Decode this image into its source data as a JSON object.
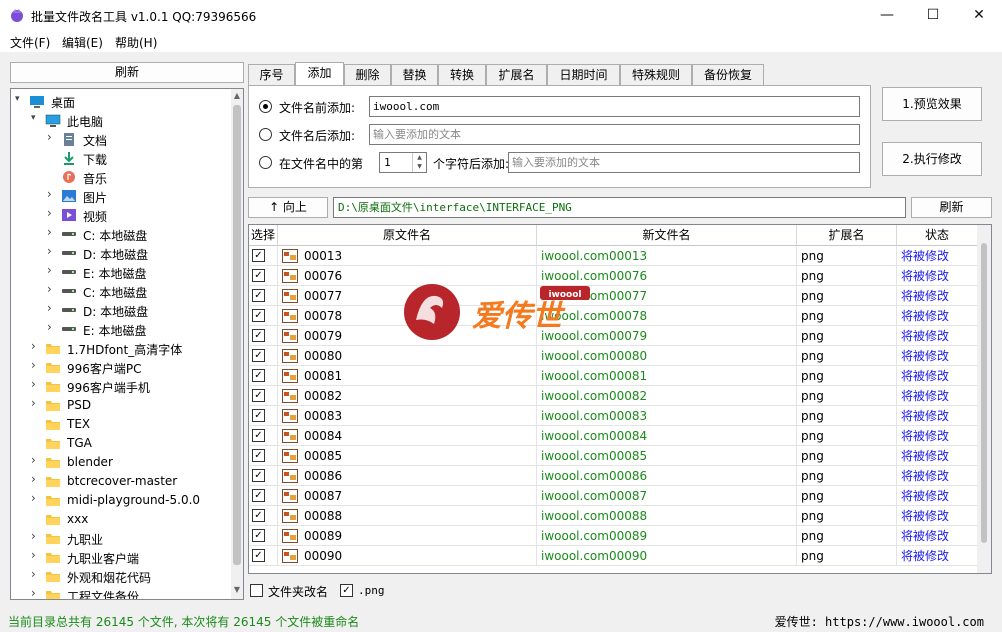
{
  "window": {
    "title": "批量文件改名工具 v1.0.1 QQ:79396566",
    "minimize": "—",
    "maximize": "☐",
    "close": "✕"
  },
  "menu": [
    "文件(F)",
    "编辑(E)",
    "帮助(H)"
  ],
  "left_panel": {
    "refresh_label": "刷新",
    "tree": [
      {
        "label": "桌面",
        "icon": "desktop-icon",
        "level": 0,
        "arrow": "open"
      },
      {
        "label": "此电脑",
        "icon": "computer-icon",
        "level": 1,
        "arrow": "open"
      },
      {
        "label": "文档",
        "icon": "document-icon",
        "level": 2,
        "arrow": "closed"
      },
      {
        "label": "下载",
        "icon": "download-icon",
        "level": 2,
        "arrow": "none"
      },
      {
        "label": "音乐",
        "icon": "music-icon",
        "level": 2,
        "arrow": "none"
      },
      {
        "label": "图片",
        "icon": "picture-icon",
        "level": 2,
        "arrow": "closed"
      },
      {
        "label": "视频",
        "icon": "video-icon",
        "level": 2,
        "arrow": "closed"
      },
      {
        "label": "C: 本地磁盘",
        "icon": "drive-icon",
        "level": 2,
        "arrow": "closed"
      },
      {
        "label": "D: 本地磁盘",
        "icon": "drive-icon",
        "level": 2,
        "arrow": "closed"
      },
      {
        "label": "E: 本地磁盘",
        "icon": "drive-icon",
        "level": 2,
        "arrow": "closed"
      },
      {
        "label": "C: 本地磁盘",
        "icon": "drive-icon",
        "level": 2,
        "arrow": "closed"
      },
      {
        "label": "D: 本地磁盘",
        "icon": "drive-icon",
        "level": 2,
        "arrow": "closed"
      },
      {
        "label": "E: 本地磁盘",
        "icon": "drive-icon",
        "level": 2,
        "arrow": "closed"
      },
      {
        "label": "1.7HDfont_高清字体",
        "icon": "folder-icon",
        "level": 1,
        "arrow": "closed"
      },
      {
        "label": "996客户端PC",
        "icon": "folder-icon",
        "level": 1,
        "arrow": "closed"
      },
      {
        "label": "996客户端手机",
        "icon": "folder-icon",
        "level": 1,
        "arrow": "closed"
      },
      {
        "label": "PSD",
        "icon": "folder-icon",
        "level": 1,
        "arrow": "closed"
      },
      {
        "label": "TEX",
        "icon": "folder-icon",
        "level": 1,
        "arrow": "none"
      },
      {
        "label": "TGA",
        "icon": "folder-icon",
        "level": 1,
        "arrow": "none"
      },
      {
        "label": "blender",
        "icon": "folder-icon",
        "level": 1,
        "arrow": "closed"
      },
      {
        "label": "btcrecover-master",
        "icon": "folder-icon",
        "level": 1,
        "arrow": "closed"
      },
      {
        "label": "midi-playground-5.0.0",
        "icon": "folder-icon",
        "level": 1,
        "arrow": "closed"
      },
      {
        "label": "xxx",
        "icon": "folder-icon",
        "level": 1,
        "arrow": "none"
      },
      {
        "label": "九职业",
        "icon": "folder-icon",
        "level": 1,
        "arrow": "closed"
      },
      {
        "label": "九职业客户端",
        "icon": "folder-icon",
        "level": 1,
        "arrow": "closed"
      },
      {
        "label": "外观和烟花代码",
        "icon": "folder-icon",
        "level": 1,
        "arrow": "closed"
      },
      {
        "label": "工程文件备份",
        "icon": "folder-icon",
        "level": 1,
        "arrow": "closed"
      }
    ]
  },
  "tabs": [
    {
      "label": "序号",
      "active": false
    },
    {
      "label": "添加",
      "active": true
    },
    {
      "label": "删除",
      "active": false
    },
    {
      "label": "替换",
      "active": false
    },
    {
      "label": "转换",
      "active": false
    },
    {
      "label": "扩展名",
      "active": false
    },
    {
      "label": "日期时间",
      "active": false
    },
    {
      "label": "特殊规则",
      "active": false
    },
    {
      "label": "备份恢复",
      "active": false
    }
  ],
  "add_tab": {
    "prefix_label": "文件名前添加:",
    "prefix_value": "iwoool.com",
    "suffix_label": "文件名后添加:",
    "suffix_placeholder": "输入要添加的文本",
    "middle_label_a": "在文件名中的第",
    "middle_position": "1",
    "middle_label_b": "个字符后添加:",
    "middle_placeholder": "输入要添加的文本",
    "selected": "prefix"
  },
  "actions": {
    "preview_label": "1.预览效果",
    "execute_label": "2.执行修改"
  },
  "nav": {
    "up_label": "↑ 向上",
    "path": "D:\\原桌面文件\\interface\\INTERFACE_PNG",
    "refresh_label": "刷新"
  },
  "grid": {
    "headers": [
      "选择",
      "原文件名",
      "新文件名",
      "扩展名",
      "状态"
    ],
    "rows": [
      {
        "orig": "00013",
        "new": "iwoool.com00013",
        "ext": "png",
        "status": "将被修改",
        "checked": true
      },
      {
        "orig": "00076",
        "new": "iwoool.com00076",
        "ext": "png",
        "status": "将被修改",
        "checked": true
      },
      {
        "orig": "00077",
        "new": "iwoool.com00077",
        "ext": "png",
        "status": "将被修改",
        "checked": true
      },
      {
        "orig": "00078",
        "new": "iwoool.com00078",
        "ext": "png",
        "status": "将被修改",
        "checked": true
      },
      {
        "orig": "00079",
        "new": "iwoool.com00079",
        "ext": "png",
        "status": "将被修改",
        "checked": true
      },
      {
        "orig": "00080",
        "new": "iwoool.com00080",
        "ext": "png",
        "status": "将被修改",
        "checked": true
      },
      {
        "orig": "00081",
        "new": "iwoool.com00081",
        "ext": "png",
        "status": "将被修改",
        "checked": true
      },
      {
        "orig": "00082",
        "new": "iwoool.com00082",
        "ext": "png",
        "status": "将被修改",
        "checked": true
      },
      {
        "orig": "00083",
        "new": "iwoool.com00083",
        "ext": "png",
        "status": "将被修改",
        "checked": true
      },
      {
        "orig": "00084",
        "new": "iwoool.com00084",
        "ext": "png",
        "status": "将被修改",
        "checked": true
      },
      {
        "orig": "00085",
        "new": "iwoool.com00085",
        "ext": "png",
        "status": "将被修改",
        "checked": true
      },
      {
        "orig": "00086",
        "new": "iwoool.com00086",
        "ext": "png",
        "status": "将被修改",
        "checked": true
      },
      {
        "orig": "00087",
        "new": "iwoool.com00087",
        "ext": "png",
        "status": "将被修改",
        "checked": true
      },
      {
        "orig": "00088",
        "new": "iwoool.com00088",
        "ext": "png",
        "status": "将被修改",
        "checked": true
      },
      {
        "orig": "00089",
        "new": "iwoool.com00089",
        "ext": "png",
        "status": "将被修改",
        "checked": true
      },
      {
        "orig": "00090",
        "new": "iwoool.com00090",
        "ext": "png",
        "status": "将被修改",
        "checked": true
      }
    ]
  },
  "bottom_options": {
    "folder_rename_label": "文件夹改名",
    "folder_rename_checked": false,
    "ext_filter_label": ".png",
    "ext_filter_checked": true
  },
  "status": {
    "left": "当前目录总共有 26145 个文件, 本次将有 26145 个文件被重命名",
    "right": "爱传世: https://www.iwoool.com"
  },
  "watermark": {
    "text": "爱传世",
    "badge": "iwoool"
  },
  "colors": {
    "new_name": "#1a8a1a",
    "status": "#1a1aee",
    "path": "#0a6e0a",
    "status_bar": "#1a8a1a",
    "watermark_red": "#b8252a",
    "watermark_orange": "#f47a20"
  }
}
